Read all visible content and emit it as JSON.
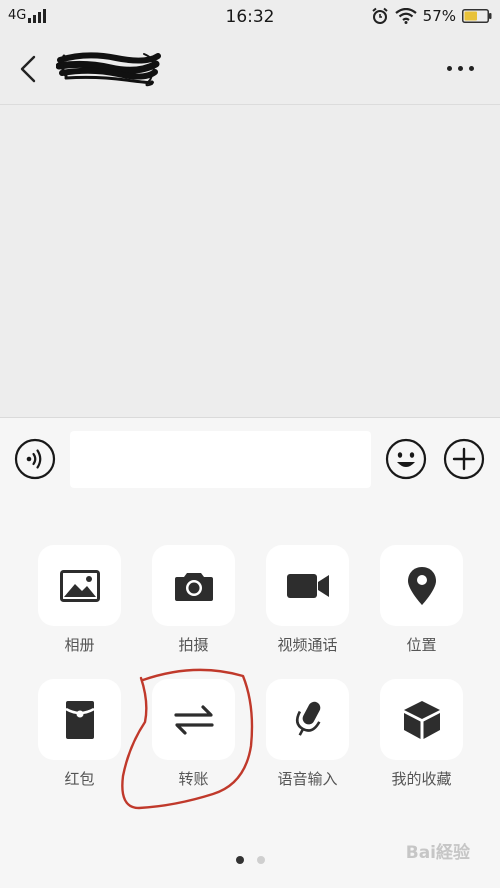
{
  "status_bar": {
    "network": "4G",
    "time": "16:32",
    "battery": "57%",
    "icons": [
      "signal-bars-icon",
      "alarm-clock-icon",
      "wifi-icon",
      "battery-icon"
    ],
    "battery_level": 0.57,
    "battery_color": "#e8c23a"
  },
  "nav": {
    "contact_name": "",
    "icons": [
      "back-chevron-icon",
      "more-dots-icon"
    ]
  },
  "input_bar": {
    "message_value": "",
    "icons": [
      "voice-icon",
      "emoji-icon",
      "plus-icon"
    ]
  },
  "panel": {
    "items": [
      {
        "label": "相册",
        "icon": "photo-album-icon"
      },
      {
        "label": "拍摄",
        "icon": "camera-icon"
      },
      {
        "label": "视频通话",
        "icon": "video-call-icon"
      },
      {
        "label": "位置",
        "icon": "location-pin-icon"
      },
      {
        "label": "红包",
        "icon": "red-packet-icon"
      },
      {
        "label": "转账",
        "icon": "transfer-arrows-icon"
      },
      {
        "label": "语音输入",
        "icon": "microphone-icon"
      },
      {
        "label": "我的收藏",
        "icon": "favorites-cube-icon"
      }
    ],
    "page_count": 2,
    "current_page": 1
  },
  "annotation": {
    "color": "#c0392b"
  },
  "watermark": {
    "text": "Bai経验"
  }
}
